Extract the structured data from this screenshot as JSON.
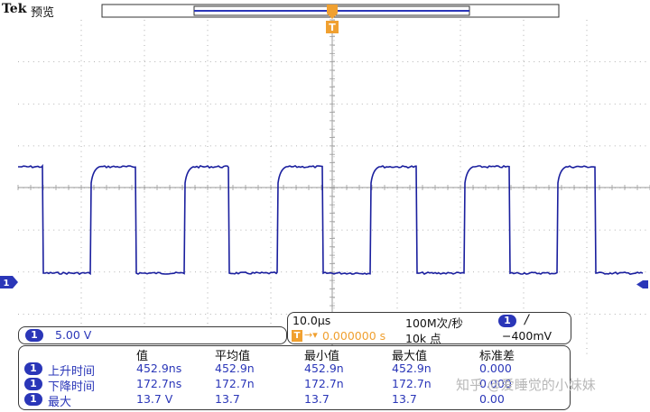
{
  "header": {
    "brand": "Tek",
    "mode": "预览",
    "trigger_marker": "T"
  },
  "channel": {
    "badge": "1",
    "scale": "5.00 V"
  },
  "timebase": {
    "horizontal_scale": "10.0µs",
    "sample_rate": "100M次/秒",
    "trigger_badge": "1",
    "trigger_slope": "/",
    "position_marker": "T",
    "position_arrow": "→▾",
    "position_value": "0.000000 s",
    "record_length": "10k 点",
    "trigger_level": "−400mV"
  },
  "measurements": {
    "columns": [
      "值",
      "平均值",
      "最小值",
      "最大值",
      "标准差"
    ],
    "rows": [
      {
        "badge": "1",
        "name": "上升时间",
        "values": [
          "452.9ns",
          "452.9n",
          "452.9n",
          "452.9n",
          "0.000"
        ]
      },
      {
        "badge": "1",
        "name": "下降时间",
        "values": [
          "172.7ns",
          "172.7n",
          "172.7n",
          "172.7n",
          "0.000"
        ]
      },
      {
        "badge": "1",
        "name": "最大",
        "values": [
          "13.7 V",
          "13.7",
          "13.7",
          "13.7",
          "0.00"
        ]
      }
    ]
  },
  "watermark": "知乎 @爱睡觉的小妹妹",
  "colors": {
    "trace": "#1a1f9e",
    "accent": "#2a36b8",
    "trigger": "#f0a030",
    "grid": "#9a9a9a"
  }
}
